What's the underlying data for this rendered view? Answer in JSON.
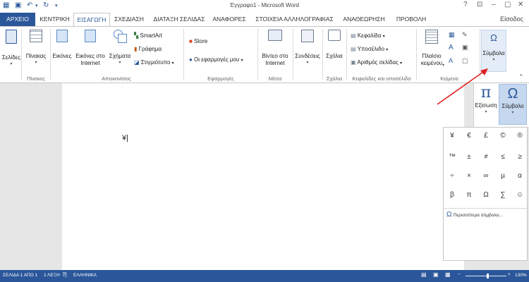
{
  "window": {
    "title": "Έγγραφο1 - Microsoft Word",
    "help": "?",
    "signin": "Είσοδος"
  },
  "tabs": [
    "ΑΡΧΕΙΟ",
    "ΚΕΝΤΡΙΚΗ",
    "ΕΙΣΑΓΩΓΗ",
    "ΣΧΕΔΙΑΣΗ",
    "ΔΙΑΤΑΞΗ ΣΕΛΙΔΑΣ",
    "ΑΝΑΦΟΡΕΣ",
    "ΣΤΟΙΧΕΙΑ ΑΛΛΗΛΟΓΡΑΦΙΑΣ",
    "ΑΝΑΘΕΩΡΗΣΗ",
    "ΠΡΟΒΟΛΗ"
  ],
  "ribbon": {
    "pages": "Σελίδες",
    "table": "Πίνακας",
    "pictures": "Εικόνες",
    "online_pictures_1": "Εικόνες στο",
    "online_pictures_2": "Internet",
    "shapes": "Σχήματα",
    "smartart": "SmartArt",
    "chart": "Γράφημα",
    "screenshot": "Στιγμιότυπο",
    "store": "Store",
    "myapps": "Οι εφαρμογές μου",
    "video_1": "Βίντεο στο",
    "video_2": "Internet",
    "links": "Συνδέσεις",
    "comment": "Σχόλια",
    "header": "Κεφαλίδα",
    "footer": "Υποσέλιδο",
    "page_number": "Αριθμός σελίδας",
    "textbox_1": "Πλαίσιο",
    "textbox_2": "κειμένου",
    "symbols": "Σύμβολα",
    "groups": {
      "pages": "",
      "tables": "Πίνακες",
      "illustrations": "Απεικονίσεις",
      "apps": "Εφαρμογές",
      "media": "Μέσα",
      "comments": "Σχόλια",
      "header_footer": "Κεφαλίδες και υποσέλιδα",
      "text": "Κείμενο"
    }
  },
  "document": {
    "typed_text": "¥"
  },
  "symbol_panel": {
    "equation": "Εξίσωση",
    "symbol": "Σύμβολο",
    "equation_glyph": "π",
    "symbol_glyph": "Ω",
    "grid": [
      "¥",
      "€",
      "£",
      "©",
      "®",
      "™",
      "±",
      "≠",
      "≤",
      "≥",
      "÷",
      "×",
      "∞",
      "µ",
      "α",
      "β",
      "π",
      "Ω",
      "∑",
      "☺"
    ],
    "more": "Περισσότερα σύμβολα..."
  },
  "statusbar": {
    "page": "ΣΕΛΙΔΑ 1 ΑΠΟ 1",
    "words": "1 ΛΕΞΗ",
    "language": "ΕΛΛΗΝΙΚΑ",
    "zoom": "130%"
  },
  "colors": {
    "accent": "#2b579a",
    "arrow": "#e02020"
  }
}
